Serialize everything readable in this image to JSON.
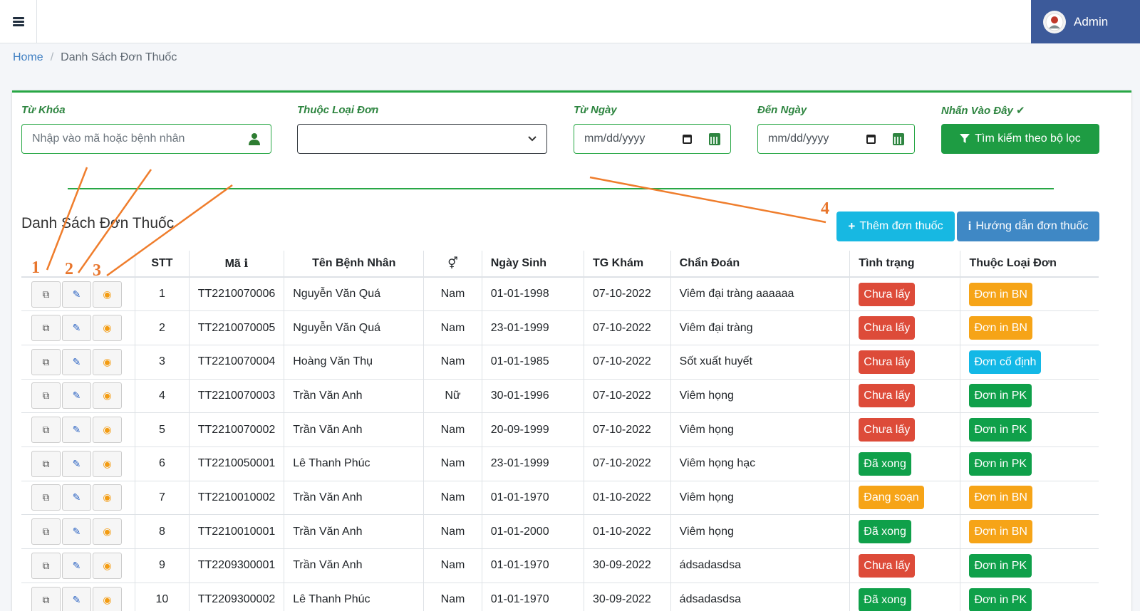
{
  "header": {
    "user_name": "Admin"
  },
  "breadcrumb": {
    "home": "Home",
    "current": "Danh Sách Đơn Thuốc"
  },
  "filters": {
    "keyword_label": "Từ Khóa",
    "keyword_placeholder": "Nhập vào mã hoặc bệnh nhân",
    "type_label": "Thuộc Loại Đơn",
    "type_value": "",
    "from_label": "Từ Ngày",
    "from_value": "mm/dd/yyyy",
    "to_label": "Đến Ngày",
    "to_value": "mm/dd/yyyy",
    "click_label": "Nhấn Vào Đây ✔",
    "search_button": "Tìm kiếm theo bộ lọc"
  },
  "list": {
    "title": "Danh Sách Đơn Thuốc",
    "add_button": "Thêm đơn thuốc",
    "guide_button": "Hướng dẫn đơn thuốc"
  },
  "table": {
    "headers": [
      "STT",
      "Mã",
      "Tên Bệnh Nhân",
      "⚥",
      "Ngày Sinh",
      "TG Khám",
      "Chẩn Đoán",
      "Tình trạng",
      "Thuộc Loại Đơn"
    ],
    "rows": [
      {
        "stt": "1",
        "ma": "TT2210070006",
        "ten": "Nguyễn Văn Quá",
        "gioi": "Nam",
        "sinh": "01-01-1998",
        "kham": "07-10-2022",
        "chandoan": "Viêm đại tràng aaaaaa",
        "tinhtrang": "Chưa lấy",
        "loaidon": "Đơn in BN"
      },
      {
        "stt": "2",
        "ma": "TT2210070005",
        "ten": "Nguyễn Văn Quá",
        "gioi": "Nam",
        "sinh": "23-01-1999",
        "kham": "07-10-2022",
        "chandoan": "Viêm đại tràng",
        "tinhtrang": "Chưa lấy",
        "loaidon": "Đơn in BN"
      },
      {
        "stt": "3",
        "ma": "TT2210070004",
        "ten": "Hoàng Văn Thụ",
        "gioi": "Nam",
        "sinh": "01-01-1985",
        "kham": "07-10-2022",
        "chandoan": "Sốt xuất huyết",
        "tinhtrang": "Chưa lấy",
        "loaidon": "Đơn cố định"
      },
      {
        "stt": "4",
        "ma": "TT2210070003",
        "ten": "Trần Văn Anh",
        "gioi": "Nữ",
        "sinh": "30-01-1996",
        "kham": "07-10-2022",
        "chandoan": "Viêm họng",
        "tinhtrang": "Chưa lấy",
        "loaidon": "Đơn in PK"
      },
      {
        "stt": "5",
        "ma": "TT2210070002",
        "ten": "Trần Văn Anh",
        "gioi": "Nam",
        "sinh": "20-09-1999",
        "kham": "07-10-2022",
        "chandoan": "Viêm họng",
        "tinhtrang": "Chưa lấy",
        "loaidon": "Đơn in PK"
      },
      {
        "stt": "6",
        "ma": "TT2210050001",
        "ten": "Lê Thanh Phúc",
        "gioi": "Nam",
        "sinh": "23-01-1999",
        "kham": "07-10-2022",
        "chandoan": "Viêm họng hạc",
        "tinhtrang": "Đã xong",
        "loaidon": "Đơn in PK"
      },
      {
        "stt": "7",
        "ma": "TT2210010002",
        "ten": "Trần Văn Anh",
        "gioi": "Nam",
        "sinh": "01-01-1970",
        "kham": "01-10-2022",
        "chandoan": "Viêm họng",
        "tinhtrang": "Đang soạn",
        "loaidon": "Đơn in BN"
      },
      {
        "stt": "8",
        "ma": "TT2210010001",
        "ten": "Trần Văn Anh",
        "gioi": "Nam",
        "sinh": "01-01-2000",
        "kham": "01-10-2022",
        "chandoan": "Viêm họng",
        "tinhtrang": "Đã xong",
        "loaidon": "Đơn in BN"
      },
      {
        "stt": "9",
        "ma": "TT2209300001",
        "ten": "Trần Văn Anh",
        "gioi": "Nam",
        "sinh": "01-01-1970",
        "kham": "30-09-2022",
        "chandoan": "ádsadasdsa",
        "tinhtrang": "Chưa lấy",
        "loaidon": "Đơn in PK"
      },
      {
        "stt": "10",
        "ma": "TT2209300002",
        "ten": "Lê Thanh Phúc",
        "gioi": "Nam",
        "sinh": "01-01-1970",
        "kham": "30-09-2022",
        "chandoan": "ádsadasdsa",
        "tinhtrang": "Đã xong",
        "loaidon": "Đơn in PK"
      }
    ]
  },
  "colors": {
    "status": {
      "Chưa lấy": "#dd4b39",
      "Đã xong": "#0fa04a",
      "Đang soạn": "#f6a417"
    },
    "type": {
      "Đơn in BN": "#f6a417",
      "Đơn in PK": "#0fa04a",
      "Đơn cố định": "#13b8e6"
    }
  },
  "annotations": [
    "1",
    "2",
    "3",
    "4"
  ]
}
